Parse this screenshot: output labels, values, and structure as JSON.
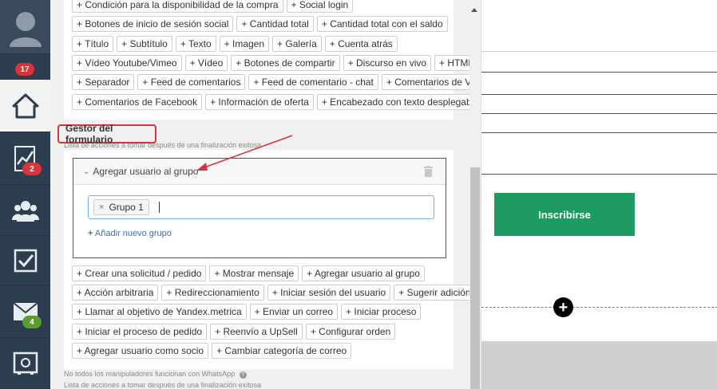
{
  "sidebar": {
    "avatar_badge": "17",
    "stats_badge": "2",
    "mail_badge": "4",
    "items": [
      {
        "icon": "user-avatar-icon"
      },
      {
        "icon": "home-icon"
      },
      {
        "icon": "chart-icon"
      },
      {
        "icon": "users-icon"
      },
      {
        "icon": "checkbox-icon"
      },
      {
        "icon": "mail-icon"
      },
      {
        "icon": "safe-icon"
      }
    ]
  },
  "elements": {
    "row0": [
      "+ Condición para la disponibilidad de la compra",
      "+ Social login"
    ],
    "row1": [
      "+ Botones de inicio de sesión social",
      "+ Cantidad total",
      "+ Cantidad total con el saldo"
    ],
    "row2": [
      "+ Título",
      "+ Subtítulo",
      "+ Texto",
      "+ Imagen",
      "+ Galería",
      "+ Cuenta atrás"
    ],
    "row3": [
      "+ Vídeo Youtube/Vimeo",
      "+ Vídeo",
      "+ Botones de compartir",
      "+ Discurso en vivo",
      "+ HTML"
    ],
    "row4": [
      "+ Separador",
      "+ Feed de comentarios",
      "+ Feed de comentario - chat",
      "+ Comentarios de VK"
    ],
    "row5": [
      "+ Comentarios de Facebook",
      "+ Información de oferta",
      "+ Encabezado con texto desplegable"
    ]
  },
  "form_handler": {
    "title": "Gestor del formulario",
    "subtitle": "Lista de acciones a tomar después de una finalización exitosa",
    "action": {
      "label": "Agregar usuario al grupo",
      "chip": "Grupo 1",
      "chip_remove": "×",
      "add_link": "Añadir nuevo grupo",
      "add_icon": "+"
    }
  },
  "actions": {
    "row0": [
      "+ Crear una solicitud / pedido",
      "+ Mostrar mensaje",
      "+ Agregar usuario al grupo"
    ],
    "row1": [
      "+ Acción arbitraria",
      "+ Redireccionamiento",
      "+ Iniciar sesión del usuario",
      "+ Sugerir adición"
    ],
    "row2": [
      "+ Llamar al objetivo de Yandex.metrica",
      "+ Enviar un correo",
      "+ Iniciar proceso"
    ],
    "row3": [
      "+ Iniciar el proceso de pedido",
      "+ Reenvío a UpSell",
      "+ Configurar orden"
    ],
    "row4": [
      "+ Agregar usuario como socio",
      "+ Cambiar categoría de correo"
    ]
  },
  "footer": {
    "whatsapp_note": "No todos los manipuladores funcionan con WhatsApp",
    "subtitle_repeat": "Lista de acciones a tomar después de una finalización exitosa"
  },
  "preview": {
    "subscribe_label": "Inscribirse",
    "plus": "+"
  },
  "colors": {
    "sidebar": "#2d3e50",
    "badge_red": "#d9343a",
    "badge_green": "#5c9b2e",
    "accent_blue": "#3a72b5",
    "subscribe_green": "#1e9b63",
    "highlight_red": "#d9343a"
  }
}
